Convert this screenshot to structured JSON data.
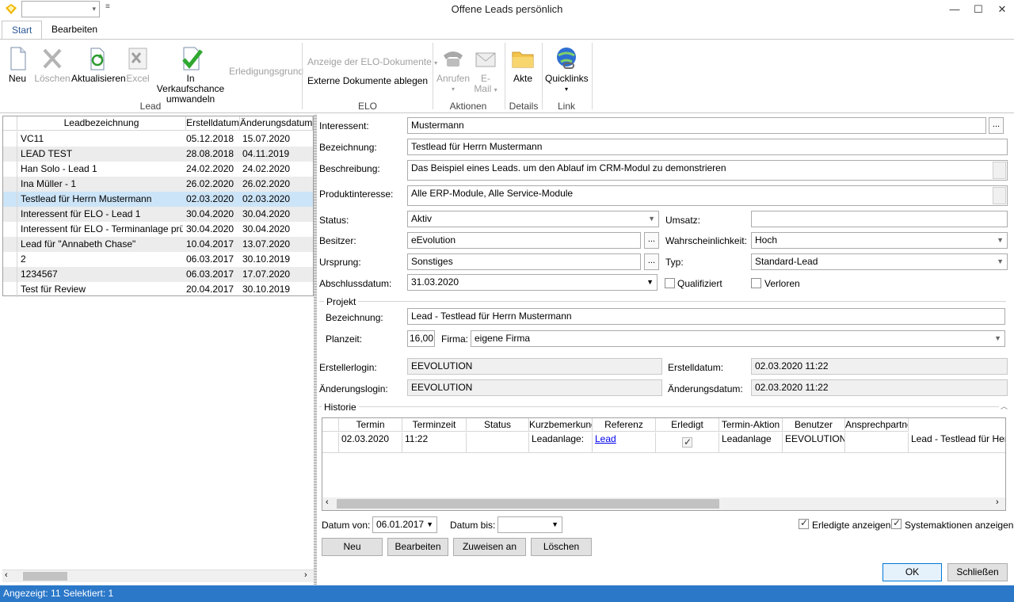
{
  "window": {
    "title": "Offene Leads persönlich",
    "minimize": "—",
    "maximize": "☐",
    "close": "✕"
  },
  "tabs": [
    "Start",
    "Bearbeiten"
  ],
  "ribbon": {
    "lead": {
      "label": "Lead",
      "neu": "Neu",
      "loeschen": "Löschen",
      "aktualisieren": "Aktualisieren",
      "excel": "Excel",
      "umwandeln1": "In Verkaufschance",
      "umwandeln2": "umwandeln",
      "erledigungsgrund": "Erledigungsgrund"
    },
    "elo": {
      "label": "ELO",
      "anzeige": "Anzeige der ELO-Dokumente",
      "extern": "Externe Dokumente ablegen"
    },
    "aktionen": {
      "label": "Aktionen",
      "anrufen": "Anrufen",
      "email1": "E-",
      "email2": "Mail"
    },
    "details": {
      "label": "Details",
      "akte": "Akte"
    },
    "link": {
      "label": "Link",
      "quicklinks": "Quicklinks"
    }
  },
  "list": {
    "headers": [
      "Leadbezeichnung",
      "Erstelldatum",
      "Änderungsdatum"
    ],
    "rows": [
      [
        "VC11",
        "05.12.2018",
        "15.07.2020"
      ],
      [
        "LEAD TEST",
        "28.08.2018",
        "04.11.2019"
      ],
      [
        "Han Solo - Lead 1",
        "24.02.2020",
        "24.02.2020"
      ],
      [
        "Ina Müller - 1",
        "26.02.2020",
        "26.02.2020"
      ],
      [
        "Testlead für Herrn Mustermann",
        "02.03.2020",
        "02.03.2020"
      ],
      [
        "Interessent für ELO - Lead 1",
        "30.04.2020",
        "30.04.2020"
      ],
      [
        "Interessent für ELO - Terminanlage prüfen",
        "30.04.2020",
        "30.04.2020"
      ],
      [
        "Lead für \"Annabeth Chase\"",
        "10.04.2017",
        "13.07.2020"
      ],
      [
        "2",
        "06.03.2017",
        "30.10.2019"
      ],
      [
        "1234567",
        "06.03.2017",
        "17.07.2020"
      ],
      [
        "Test für Review",
        "20.04.2017",
        "30.10.2019"
      ]
    ],
    "selected_index": 4
  },
  "form": {
    "interessent": {
      "label": "Interessent:",
      "value": "Mustermann"
    },
    "bezeichnung": {
      "label": "Bezeichnung:",
      "value": "Testlead für Herrn Mustermann"
    },
    "beschreibung": {
      "label": "Beschreibung:",
      "value": "Das Beispiel eines Leads. um den Ablauf im CRM-Modul zu demonstrieren"
    },
    "produktinteresse": {
      "label": "Produktinteresse:",
      "value": "Alle ERP-Module, Alle Service-Module"
    },
    "status": {
      "label": "Status:",
      "value": "Aktiv"
    },
    "umsatz": {
      "label": "Umsatz:",
      "value": ""
    },
    "besitzer": {
      "label": "Besitzer:",
      "value": "eEvolution"
    },
    "wahrscheinlichkeit": {
      "label": "Wahrscheinlichkeit:",
      "value": "Hoch"
    },
    "ursprung": {
      "label": "Ursprung:",
      "value": "Sonstiges"
    },
    "typ": {
      "label": "Typ:",
      "value": "Standard-Lead"
    },
    "abschlussdatum": {
      "label": "Abschlussdatum:",
      "value": "31.03.2020"
    },
    "qualifiziert": {
      "label": "Qualifiziert",
      "checked": false
    },
    "verloren": {
      "label": "Verloren",
      "checked": false
    },
    "dots": "..."
  },
  "projekt": {
    "title": "Projekt",
    "bezeichnung": {
      "label": "Bezeichnung:",
      "value": "Lead - Testlead für Herrn Mustermann"
    },
    "planzeit": {
      "label": "Planzeit:",
      "value": "16,00"
    },
    "firma": {
      "label": "Firma:",
      "value": "eigene Firma"
    }
  },
  "audit": {
    "erstellerlogin": {
      "label": "Erstellerlogin:",
      "value": "EEVOLUTION"
    },
    "erstelldatum": {
      "label": "Erstelldatum:",
      "value": "02.03.2020 11:22"
    },
    "aenderungslogin": {
      "label": "Änderungslogin:",
      "value": "EEVOLUTION"
    },
    "aenderungsdatum": {
      "label": "Änderungsdatum:",
      "value": "02.03.2020 11:22"
    }
  },
  "historie": {
    "title": "Historie",
    "headers": [
      "Termin",
      "Terminzeit",
      "Status",
      "Kurzbemerkung",
      "Referenz",
      "Erledigt",
      "Termin-Aktion",
      "Benutzer",
      "Ansprechpartner"
    ],
    "row": {
      "termin": "02.03.2020",
      "terminzeit": "11:22",
      "status": "",
      "kurzbemerkung": "Leadanlage:",
      "referenz": "Lead",
      "erledigt": true,
      "termin_aktion": "Leadanlage",
      "benutzer": "EEVOLUTION",
      "ansprechpartner": "",
      "extra": "Lead - Testlead für Herrn"
    },
    "datum_von": {
      "label": "Datum von:",
      "value": "06.01.2017"
    },
    "datum_bis": {
      "label": "Datum bis:",
      "value": ""
    },
    "erledigte": {
      "label": "Erledigte anzeigen",
      "checked": true
    },
    "systemaktionen": {
      "label": "Systemaktionen anzeigen",
      "checked": true
    },
    "buttons": {
      "neu": "Neu",
      "bearbeiten": "Bearbeiten",
      "zuweisen": "Zuweisen an",
      "loeschen": "Löschen"
    }
  },
  "footer": {
    "ok": "OK",
    "schliessen": "Schließen"
  },
  "statusbar": {
    "text": "Angezeigt: 11 Selektiert: 1"
  },
  "colors": {
    "accent": "#2b78c9",
    "selection": "#cce4f7"
  }
}
